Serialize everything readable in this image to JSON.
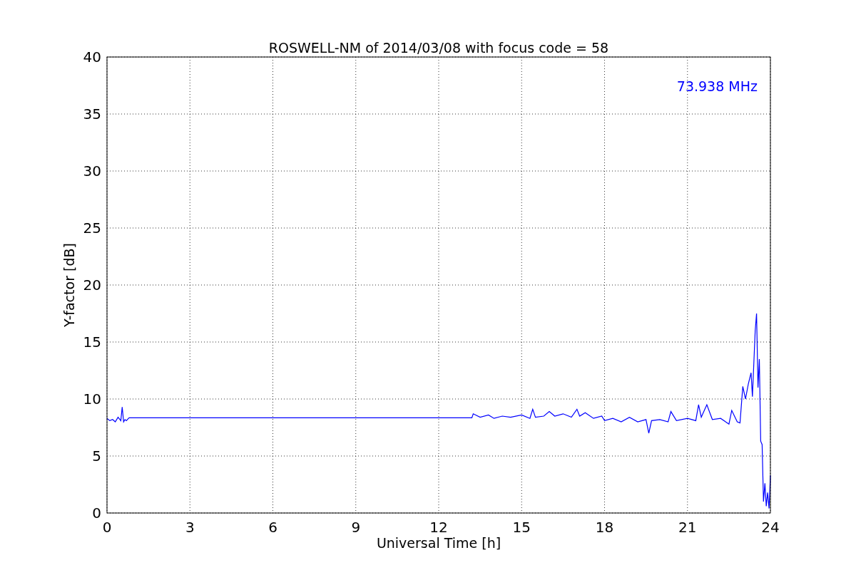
{
  "chart_data": {
    "type": "line",
    "title": "ROSWELL-NM of 2014/03/08 with focus code = 58",
    "xlabel": "Universal Time [h]",
    "ylabel": "Y-factor [dB]",
    "x": [
      0,
      0.1,
      0.2,
      0.3,
      0.4,
      0.5,
      0.55,
      0.6,
      0.65,
      0.7,
      0.8,
      13.2,
      13.25,
      13.5,
      13.8,
      14,
      14.3,
      14.6,
      15,
      15.3,
      15.4,
      15.5,
      15.8,
      16,
      16.2,
      16.5,
      16.8,
      17,
      17.1,
      17.3,
      17.6,
      17.9,
      18,
      18.3,
      18.6,
      18.9,
      19.2,
      19.5,
      19.6,
      19.7,
      20,
      20.3,
      20.4,
      20.6,
      21,
      21.3,
      21.4,
      21.5,
      21.7,
      21.9,
      22.2,
      22.5,
      22.6,
      22.8,
      22.9,
      23,
      23.1,
      23.2,
      23.3,
      23.35,
      23.45,
      23.5,
      23.55,
      23.6,
      23.65,
      23.7,
      23.75,
      23.8,
      23.85,
      23.9,
      23.95,
      24
    ],
    "series": [
      {
        "name": "73.938 MHz",
        "color": "#0000ff",
        "values": [
          8.3,
          8.1,
          8.2,
          8.0,
          8.4,
          8.1,
          9.3,
          8.0,
          8.2,
          8.1,
          8.35,
          8.35,
          8.7,
          8.4,
          8.6,
          8.3,
          8.5,
          8.4,
          8.6,
          8.3,
          9.1,
          8.4,
          8.5,
          8.9,
          8.5,
          8.7,
          8.4,
          9.1,
          8.5,
          8.8,
          8.3,
          8.5,
          8.1,
          8.3,
          8.0,
          8.4,
          8.0,
          8.2,
          7.0,
          8.1,
          8.2,
          8.0,
          8.9,
          8.1,
          8.3,
          8.1,
          9.5,
          8.4,
          9.5,
          8.2,
          8.3,
          7.8,
          9.0,
          8.0,
          7.9,
          11.1,
          10.0,
          11.3,
          12.3,
          10.2,
          16.0,
          17.5,
          11.0,
          13.5,
          6.3,
          6.0,
          1.0,
          2.6,
          0.6,
          1.8,
          0.4,
          3.3
        ]
      }
    ],
    "xlim": [
      0,
      24
    ],
    "ylim": [
      0,
      40
    ],
    "xticks": [
      0,
      3,
      6,
      9,
      12,
      15,
      18,
      21,
      24
    ],
    "yticks": [
      0,
      5,
      10,
      15,
      20,
      25,
      30,
      35,
      40
    ],
    "grid": true
  }
}
